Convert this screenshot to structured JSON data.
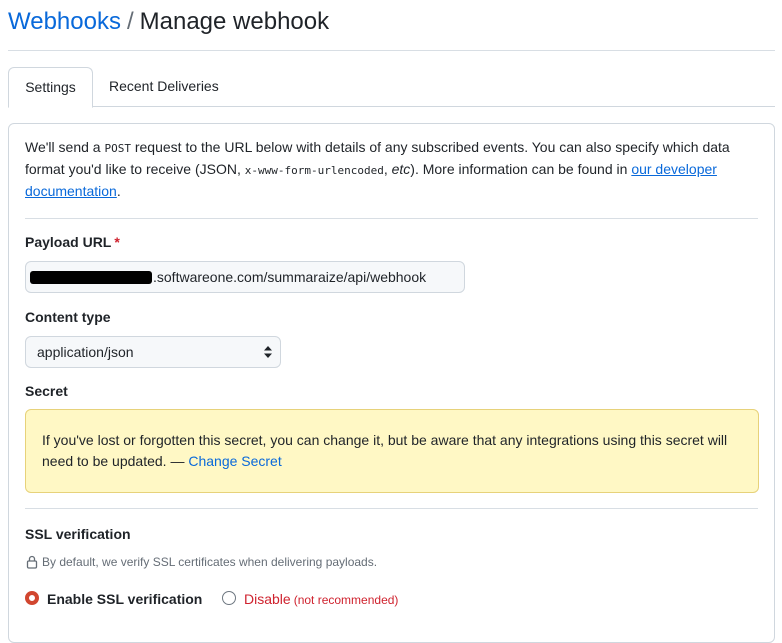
{
  "header": {
    "breadcrumb_link": "Webhooks",
    "separator": "/",
    "title": "Manage webhook"
  },
  "tabs": [
    {
      "label": "Settings",
      "active": true
    },
    {
      "label": "Recent Deliveries",
      "active": false
    }
  ],
  "intro": {
    "part1": "We'll send a ",
    "code1": "POST",
    "part2": " request to the URL below with details of any subscribed events. You can also specify which data format you'd like to receive (JSON, ",
    "code2": "x-www-form-urlencoded",
    "part3": ", ",
    "etc": "etc",
    "part4": "). More information can be found in ",
    "link": "our developer documentation",
    "part5": "."
  },
  "payload": {
    "label": "Payload URL",
    "required_mark": "*",
    "value": ".softwareone.com/summaraize/api/webhook"
  },
  "content_type": {
    "label": "Content type",
    "selected": "application/json"
  },
  "secret": {
    "label": "Secret",
    "notice": "If you've lost or forgotten this secret, you can change it, but be aware that any integrations using this secret will need to be updated. — ",
    "change_link": "Change Secret",
    "notice_color": "#fff8c5"
  },
  "ssl": {
    "label": "SSL verification",
    "note": "By default, we verify SSL certificates when delivering payloads.",
    "enable_label": "Enable SSL verification",
    "disable_label": "Disable",
    "disable_note": "(not recommended)",
    "selected": "enable"
  },
  "colors": {
    "link": "#0969da",
    "danger": "#cf222e",
    "radio_selected": "#d1462f"
  }
}
